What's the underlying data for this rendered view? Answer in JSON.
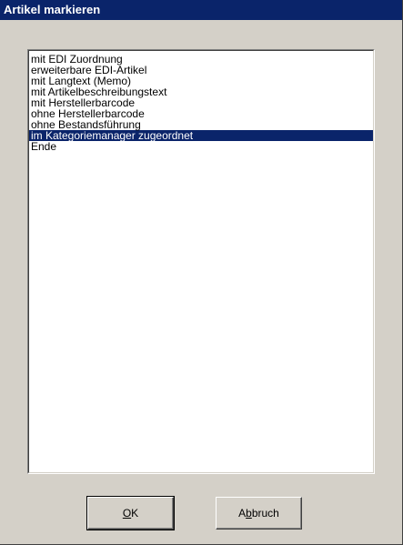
{
  "window": {
    "title": "Artikel markieren"
  },
  "listbox": {
    "items": [
      {
        "label": "mit EDI Zuordnung",
        "selected": false
      },
      {
        "label": "erweiterbare EDI-Artikel",
        "selected": false
      },
      {
        "label": "mit Langtext (Memo)",
        "selected": false
      },
      {
        "label": "mit Artikelbeschreibungstext",
        "selected": false
      },
      {
        "label": "mit Herstellerbarcode",
        "selected": false
      },
      {
        "label": "ohne Herstellerbarcode",
        "selected": false
      },
      {
        "label": "ohne Bestandsführung",
        "selected": false
      },
      {
        "label": "im Kategoriemanager zugeordnet",
        "selected": true
      },
      {
        "label": "Ende",
        "selected": false
      }
    ]
  },
  "buttons": {
    "ok": {
      "mnemonic": "O",
      "rest": "K"
    },
    "cancel": {
      "prefix": "A",
      "mnemonic": "b",
      "rest": "bruch"
    }
  },
  "colors": {
    "titlebar": "#0a246a",
    "selection": "#0a246a",
    "face": "#d4d0c8"
  }
}
